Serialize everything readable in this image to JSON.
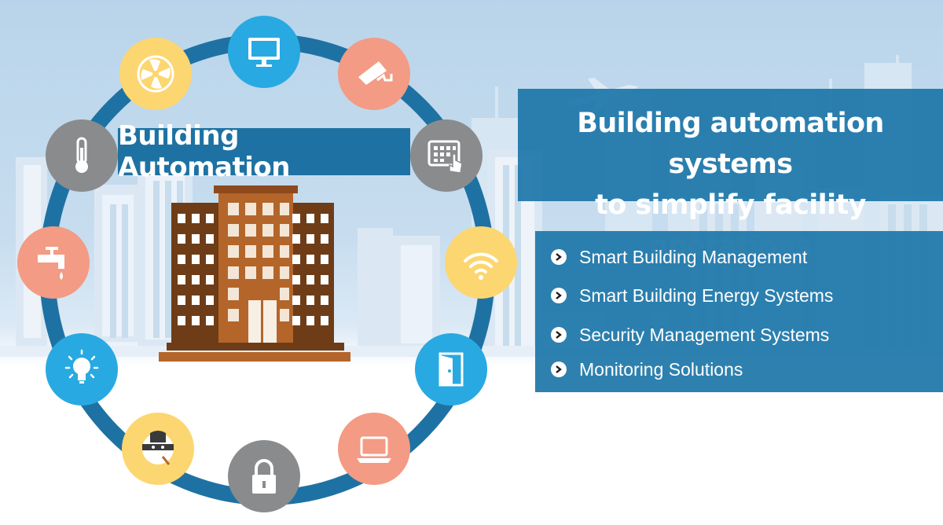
{
  "banner": {
    "title": "Building Automation"
  },
  "headline": {
    "line1": "Building automation systems",
    "line2": "to simplify facility operations"
  },
  "features": [
    "Smart Building Management",
    "Smart Building Energy Systems",
    "Security Management Systems",
    "Monitoring Solutions"
  ],
  "ring_icons": [
    "monitor-icon",
    "security-camera-icon",
    "keypad-touch-icon",
    "wifi-icon",
    "door-icon",
    "laptop-icon",
    "padlock-icon",
    "masked-intruder-icon",
    "light-bulb-icon",
    "water-tap-icon",
    "thermometer-icon",
    "fan-icon"
  ],
  "colors": {
    "ring_blue": "#1e72a3",
    "panel_blue": "#1c76a8",
    "icon_blue": "#29a9e1",
    "icon_peach": "#f39b84",
    "icon_gray": "#8a8b8d",
    "icon_yellow": "#fcd670",
    "building_brown": "#6e3d17",
    "building_orange": "#b4652a"
  }
}
